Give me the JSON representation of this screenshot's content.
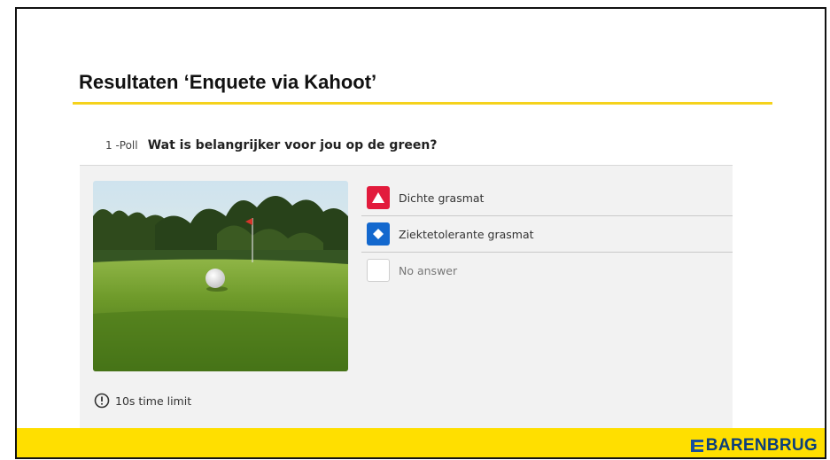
{
  "slide": {
    "title": "Resultaten ‘Enquete via Kahoot’"
  },
  "question": {
    "number": "1 -Poll",
    "text": "Wat is belangrijker voor jou op de green?"
  },
  "answers": [
    {
      "label": "Dichte grasmat",
      "icon": "triangle-icon",
      "color": "#e21b3c"
    },
    {
      "label": "Ziektetolerante grasmat",
      "icon": "diamond-icon",
      "color": "#1368ce"
    },
    {
      "label": "No answer",
      "icon": "empty-box",
      "color": "#ffffff"
    }
  ],
  "time_limit": "10s time limit",
  "footer": {
    "logo_text": "BARENBRUG",
    "color": "#ffdf00"
  },
  "accent_color": "#f5d21b"
}
